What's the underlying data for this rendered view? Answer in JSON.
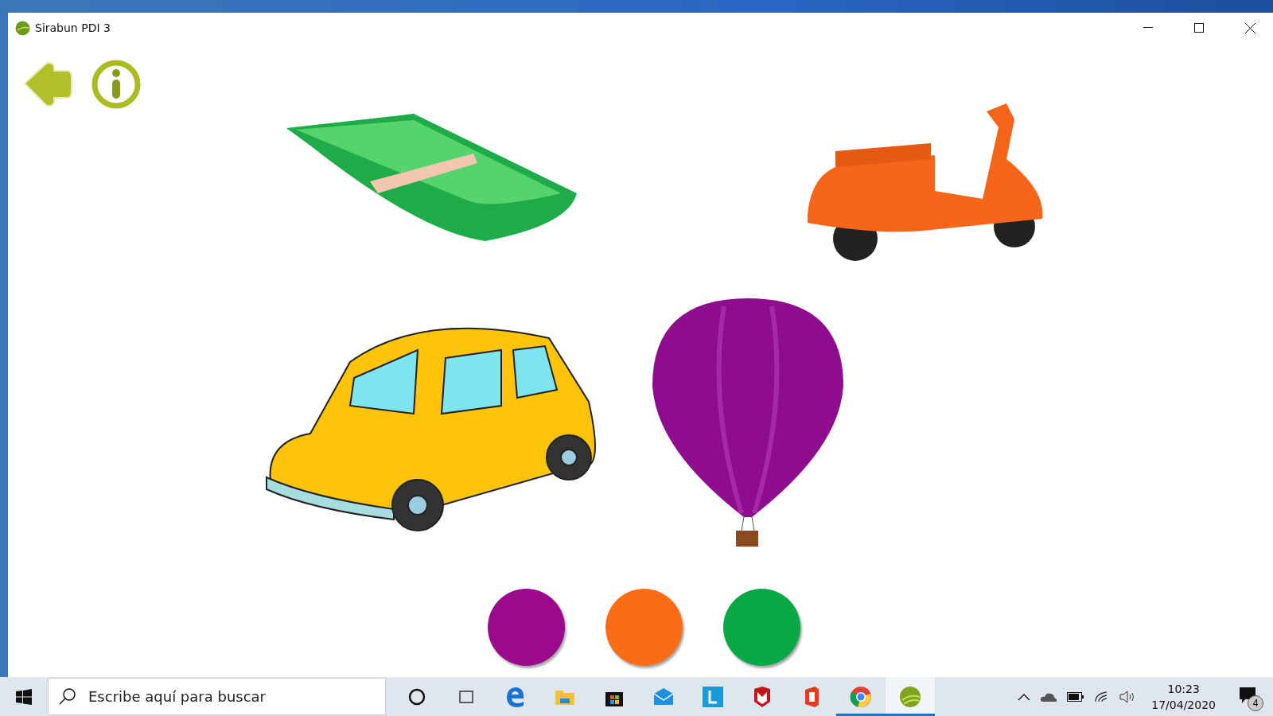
{
  "window": {
    "title": "Sirabun PDI 3"
  },
  "toolbar": {
    "buttons": [
      {
        "kind": "back"
      },
      {
        "kind": "info"
      }
    ]
  },
  "pictures": [
    {
      "kind": "boat"
    },
    {
      "kind": "scooter"
    },
    {
      "kind": "car"
    },
    {
      "kind": "balloon"
    }
  ],
  "color_options": [
    {
      "color": "#9b0a8a"
    },
    {
      "color": "#fb6d14"
    },
    {
      "color": "#08a845"
    }
  ],
  "taskbar": {
    "search": {
      "placeholder": "Escribe aquí para buscar"
    },
    "apps": [
      {
        "kind": "cortana",
        "running": false,
        "selected": false
      },
      {
        "kind": "taskview",
        "running": false,
        "selected": false
      },
      {
        "kind": "edge",
        "running": false,
        "selected": false
      },
      {
        "kind": "folder",
        "running": false,
        "selected": false
      },
      {
        "kind": "store",
        "running": false,
        "selected": false
      },
      {
        "kind": "mail",
        "running": false,
        "selected": false
      },
      {
        "kind": "l",
        "running": false,
        "selected": false
      },
      {
        "kind": "shield",
        "running": false,
        "selected": false
      },
      {
        "kind": "office",
        "running": false,
        "selected": false
      },
      {
        "kind": "chrome",
        "running": true,
        "selected": false
      },
      {
        "kind": "sirabun",
        "running": true,
        "selected": true
      }
    ],
    "time": "10:23",
    "date": "17/04/2020",
    "notifications": "4"
  }
}
